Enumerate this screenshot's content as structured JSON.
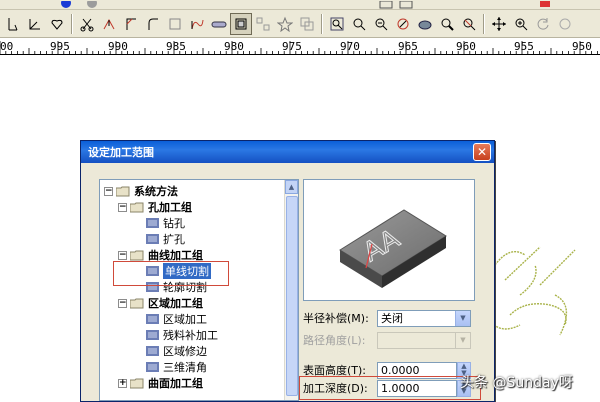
{
  "ruler": {
    "labels": [
      "00",
      "995",
      "990",
      "985",
      "980",
      "975",
      "970",
      "965",
      "960",
      "955",
      "950"
    ]
  },
  "dialog": {
    "title": "设定加工范围",
    "close_glyph": "✕",
    "tree": {
      "root": "系统方法",
      "hole_group": "孔加工组",
      "drill": "钻孔",
      "ream": "扩孔",
      "curve_group": "曲线加工组",
      "single_line_cut": "单线切割",
      "contour_cut": "轮廓切割",
      "region_group": "区域加工组",
      "region_machining": "区域加工",
      "rest_machining": "残料补加工",
      "region_trim": "区域修边",
      "chamfer_3d": "三维清角",
      "surface_group": "曲面加工组"
    },
    "preview": {
      "engraved_text": "AA"
    },
    "fields": {
      "radius_comp_label": "半径补偿(M):",
      "radius_comp_value": "关闭",
      "path_angle_label": "路径角度(L):",
      "path_angle_value": "",
      "surface_height_label": "表面高度(T):",
      "surface_height_value": "0.0000",
      "depth_label": "加工深度(D):",
      "depth_value": "1.0000"
    }
  },
  "watermark": {
    "text": "头条 @Sunday呀"
  },
  "colors": {
    "titlebar": "#0a5fd8",
    "selection": "#316ac5",
    "highlight": "#d04a3a"
  }
}
